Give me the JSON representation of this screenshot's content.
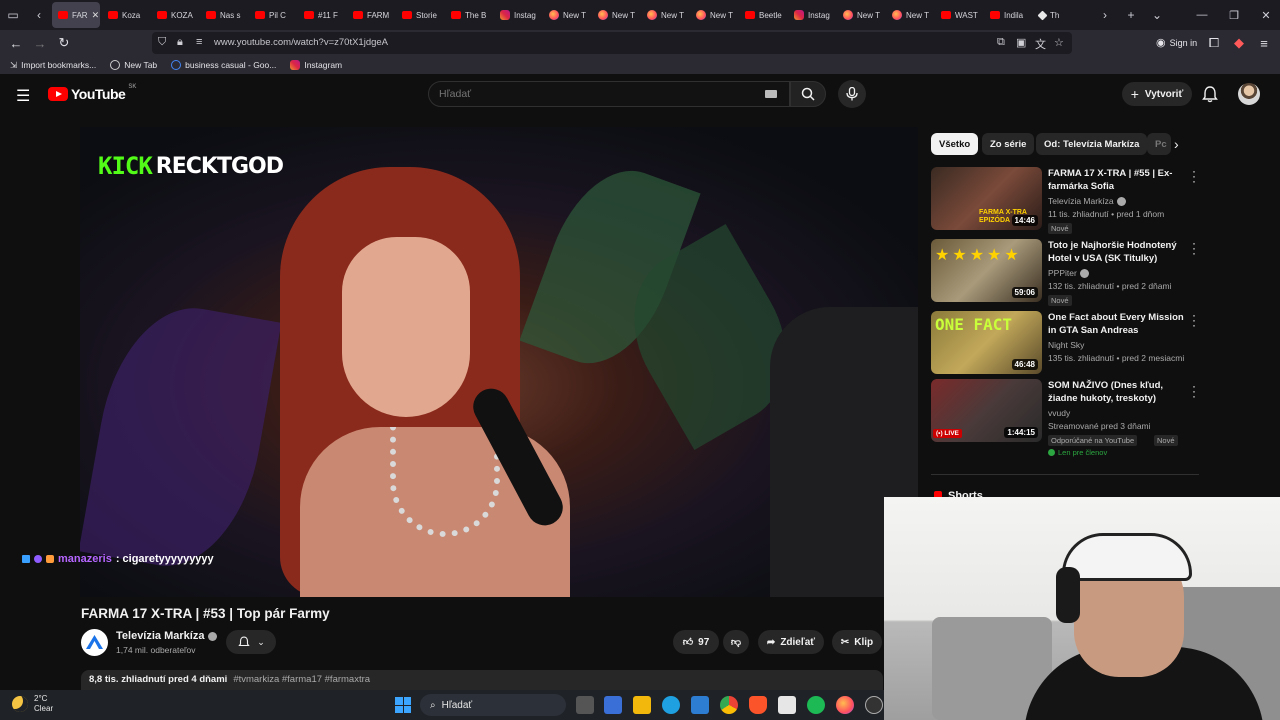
{
  "browser": {
    "tabs": [
      {
        "label": "FAR",
        "icon": "youtube-icon",
        "active": true
      },
      {
        "label": "Koza",
        "icon": "youtube-icon"
      },
      {
        "label": "KOZA",
        "icon": "youtube-icon"
      },
      {
        "label": "Nas s",
        "icon": "youtube-icon"
      },
      {
        "label": "Pil C",
        "icon": "youtube-icon"
      },
      {
        "label": "#11 F",
        "icon": "youtube-icon"
      },
      {
        "label": "FARM",
        "icon": "youtube-icon"
      },
      {
        "label": "Storie",
        "icon": "youtube-icon"
      },
      {
        "label": "The B",
        "icon": "youtube-icon"
      },
      {
        "label": "Instag",
        "icon": "instagram-icon"
      },
      {
        "label": "New T",
        "icon": "firefox-icon"
      },
      {
        "label": "New T",
        "icon": "firefox-icon"
      },
      {
        "label": "New T",
        "icon": "firefox-icon"
      },
      {
        "label": "New T",
        "icon": "firefox-icon"
      },
      {
        "label": "Beetle",
        "icon": "youtube-icon"
      },
      {
        "label": "Instag",
        "icon": "instagram-icon"
      },
      {
        "label": "New T",
        "icon": "firefox-icon"
      },
      {
        "label": "New T",
        "icon": "firefox-icon"
      },
      {
        "label": "WAST",
        "icon": "youtube-icon"
      },
      {
        "label": "Indila",
        "icon": "youtube-icon"
      },
      {
        "label": "Th",
        "icon": "notion-icon"
      }
    ],
    "url": "www.youtube.com/watch?v=z70tX1jdgeA",
    "signin_label": "Sign in",
    "bookmarks": [
      {
        "label": "Import bookmarks...",
        "icon": "import-icon"
      },
      {
        "label": "New Tab",
        "icon": "globe-icon"
      },
      {
        "label": "business casual - Goo...",
        "icon": "google-icon"
      },
      {
        "label": "Instagram",
        "icon": "instagram-icon"
      }
    ]
  },
  "youtube": {
    "logo_text": "YouTube",
    "country_code": "SK",
    "search_placeholder": "Hľadať",
    "create_label": "Vytvoriť"
  },
  "video": {
    "overlay_brand": "KICK",
    "overlay_channel": "RECKTGOD",
    "chat_user": "manazeris",
    "chat_text": ": cigaretyyyyyyyyy",
    "title": "FARMA 17 X-TRA | #53 | Top pár Farmy",
    "channel": "Televízia Markíza",
    "subscribers": "1,74 mil. odberateľov",
    "likes": "97",
    "share_label": "Zdieľať",
    "clip_label": "Klip",
    "views_meta": "8,8 tis. zhliadnutí  pred 4 dňami",
    "hashtags": "#tvmarkiza #farma17 #farmaxtra"
  },
  "sidebar": {
    "chips": [
      "Všetko",
      "Zo série",
      "Od: Televízia Markíza",
      "Pc"
    ],
    "recommendations": [
      {
        "title": "FARMA 17 X-TRA | #55 | Ex-farmárka Sofia",
        "channel": "Televízia Markíza",
        "verified": true,
        "meta": "11 tis. zhliadnutí • pred 1 dňom",
        "badge": "Nové",
        "duration": "14:46",
        "thumb_text": "FARMA X-TRA EPIZÓDA"
      },
      {
        "title": "Toto je Najhoršie Hodnotený Hotel v USA (SK Titulky)",
        "channel": "PPPiter",
        "verified": true,
        "meta": "132 tis. zhliadnutí • pred 2 dňami",
        "badge": "Nové",
        "duration": "59:06"
      },
      {
        "title": "One Fact about Every Mission in GTA San Andreas",
        "channel": "Night Sky",
        "verified": false,
        "meta": "135 tis. zhliadnutí • pred 2 mesiacmi",
        "duration": "46:48",
        "thumb_text": "ONE FACT"
      },
      {
        "title": "SOM NAŽIVO (Dnes kľud, žiadne hukoty, treskoty)",
        "channel": "vvudy",
        "verified": false,
        "meta": "Streamované pred 3 dňami",
        "badge": "Odporúčané na YouTube",
        "badge2": "Nové",
        "members": "Len pre členov",
        "duration": "1:44:15",
        "live_label": "LIVE"
      }
    ],
    "shorts_label": "Shorts"
  },
  "taskbar": {
    "temperature": "2°C",
    "condition": "Clear",
    "search_placeholder": "Hľadať"
  },
  "colors": {
    "youtube_red": "#ff0000",
    "kick_green": "#53fc18",
    "chat_user": "#b666ff",
    "background": "#0f0f0f"
  }
}
